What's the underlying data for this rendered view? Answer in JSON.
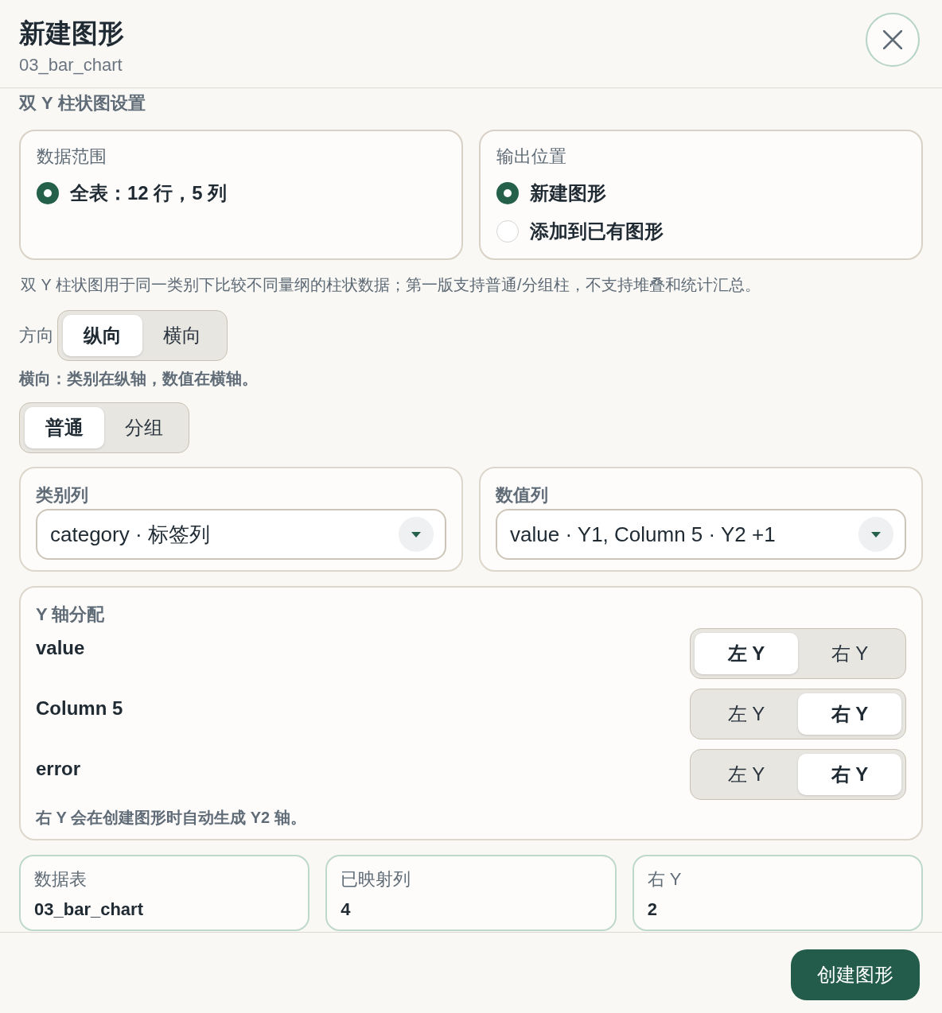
{
  "dialog": {
    "title": "新建图形",
    "subtitle": "03_bar_chart"
  },
  "section_title": "双 Y 柱状图设置",
  "data_range": {
    "label": "数据范围",
    "options": [
      {
        "label": "全表：12 行，5 列",
        "selected": true
      }
    ]
  },
  "output": {
    "label": "输出位置",
    "options": [
      {
        "label": "新建图形",
        "selected": true
      },
      {
        "label": "添加到已有图形",
        "selected": false
      }
    ]
  },
  "description": "双 Y 柱状图用于同一类别下比较不同量纲的柱状数据；第一版支持普通/分组柱，不支持堆叠和统计汇总。",
  "orientation": {
    "label": "方向",
    "options": [
      {
        "label": "纵向",
        "selected": true
      },
      {
        "label": "横向",
        "selected": false
      }
    ]
  },
  "orientation_hint": "横向：类别在纵轴，数值在横轴。",
  "bar_mode": {
    "options": [
      {
        "label": "普通",
        "selected": true
      },
      {
        "label": "分组",
        "selected": false
      }
    ]
  },
  "category_column": {
    "label": "类别列",
    "value": "category · 标签列"
  },
  "value_columns": {
    "label": "数值列",
    "value": "value · Y1, Column 5 · Y2 +1"
  },
  "y_axis": {
    "title": "Y 轴分配",
    "rows": [
      {
        "name": "value",
        "options": [
          {
            "label": "左 Y",
            "selected": true
          },
          {
            "label": "右 Y",
            "selected": false
          }
        ]
      },
      {
        "name": "Column 5",
        "options": [
          {
            "label": "左 Y",
            "selected": false
          },
          {
            "label": "右 Y",
            "selected": true
          }
        ]
      },
      {
        "name": "error",
        "options": [
          {
            "label": "左 Y",
            "selected": false
          },
          {
            "label": "右 Y",
            "selected": true
          }
        ]
      }
    ],
    "note": "右 Y 会在创建图形时自动生成 Y2 轴。"
  },
  "stats": [
    {
      "label": "数据表",
      "value": "03_bar_chart"
    },
    {
      "label": "已映射列",
      "value": "4"
    },
    {
      "label": "右 Y",
      "value": "2"
    }
  ],
  "buttons": {
    "create": "创建图形"
  }
}
